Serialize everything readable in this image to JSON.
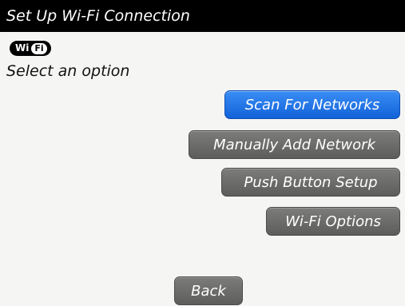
{
  "title": "Set Up Wi-Fi Connection",
  "logo": {
    "name": "wifi-logo",
    "part1": "Wi",
    "part2": "Fi"
  },
  "prompt": "Select an option",
  "options": [
    {
      "label": "Scan For Networks",
      "selected": true
    },
    {
      "label": "Manually Add Network",
      "selected": false
    },
    {
      "label": "Push Button Setup",
      "selected": false
    },
    {
      "label": "Wi-Fi Options",
      "selected": false
    }
  ],
  "back_label": "Back",
  "colors": {
    "selected_button": "#1f6ee6",
    "button": "#6b6b69",
    "title_bar": "#000000",
    "background": "#f5f6f3"
  }
}
